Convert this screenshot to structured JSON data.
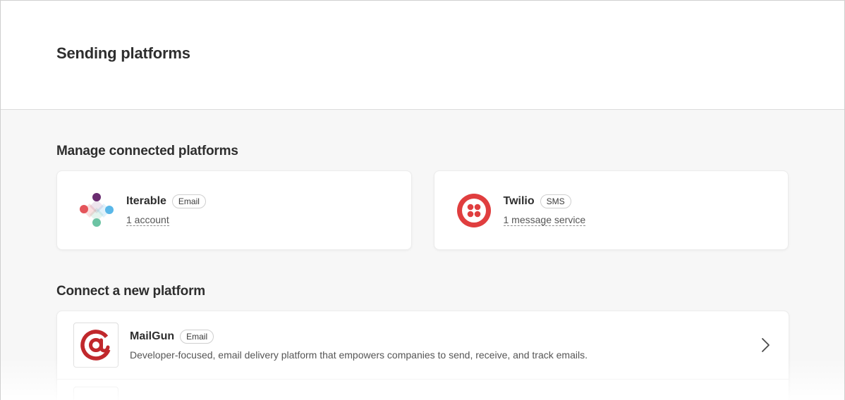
{
  "page": {
    "title": "Sending platforms"
  },
  "connected": {
    "section_title": "Manage connected platforms",
    "platforms": [
      {
        "name": "Iterable",
        "badge": "Email",
        "count_label": "1 account",
        "icon": "iterable-logo"
      },
      {
        "name": "Twilio",
        "badge": "SMS",
        "count_label": "1 message service",
        "icon": "twilio-logo"
      }
    ]
  },
  "new_platforms": {
    "section_title": "Connect a new platform",
    "items": [
      {
        "name": "MailGun",
        "badge": "Email",
        "description": "Developer-focused, email delivery platform that empowers companies to send, receive, and track emails.",
        "icon": "mailgun-logo"
      }
    ]
  },
  "colors": {
    "twilio_red": "#e03e3f",
    "mailgun_red": "#c0282c",
    "iterable_purple": "#6a2c70",
    "iterable_red": "#e4545a",
    "iterable_blue": "#59b7e8",
    "iterable_green": "#6cc3a3"
  }
}
